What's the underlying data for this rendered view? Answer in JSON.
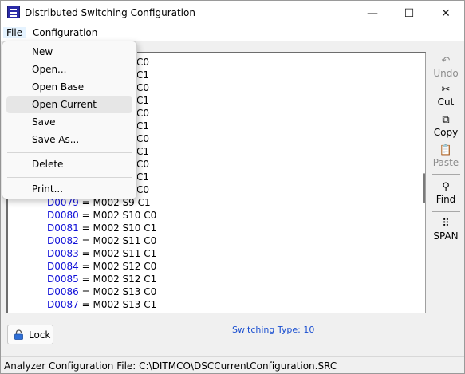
{
  "window": {
    "title": "Distributed Switching Configuration",
    "minimize": "—",
    "maximize": "☐",
    "close": "✕"
  },
  "menubar": {
    "items": [
      {
        "label": "File"
      },
      {
        "label": "Configuration"
      }
    ]
  },
  "file_menu": {
    "items": [
      {
        "label": "New"
      },
      {
        "label": "Open..."
      },
      {
        "label": "Open Base"
      },
      {
        "label": "Open Current",
        "highlighted": true
      },
      {
        "label": "Save"
      },
      {
        "label": "Save As..."
      },
      {
        "label": "Delete"
      },
      {
        "label": "Print..."
      }
    ]
  },
  "editor": {
    "partial_lines": [
      "C0",
      "C1",
      "C0",
      "C1",
      "C0",
      "C1",
      "C0",
      "C1",
      "C0",
      "C1",
      "C0"
    ],
    "lines": [
      {
        "key": "D0079",
        "value": " = M002 S9 C1"
      },
      {
        "key": "D0080",
        "value": " = M002 S10 C0"
      },
      {
        "key": "D0081",
        "value": " = M002 S10 C1"
      },
      {
        "key": "D0082",
        "value": " = M002 S11 C0"
      },
      {
        "key": "D0083",
        "value": " = M002 S11 C1"
      },
      {
        "key": "D0084",
        "value": " = M002 S12 C0"
      },
      {
        "key": "D0085",
        "value": " = M002 S12 C1"
      },
      {
        "key": "D0086",
        "value": " = M002 S13 C0"
      },
      {
        "key": "D0087",
        "value": " = M002 S13 C1"
      }
    ]
  },
  "toolbar": {
    "undo": "Undo",
    "cut": "Cut",
    "copy": "Copy",
    "paste": "Paste",
    "find": "Find",
    "span": "SPAN"
  },
  "lock_button": {
    "label": "Lock"
  },
  "switching_type": "Switching Type:  10",
  "status": "Analyzer Configuration File: C:\\DITMCO\\DSCCurrentConfiguration.SRC",
  "colors": {
    "key_blue": "#1010d8",
    "switching_type_blue": "#1a4fd0",
    "app_icon": "#2a2aa8"
  }
}
